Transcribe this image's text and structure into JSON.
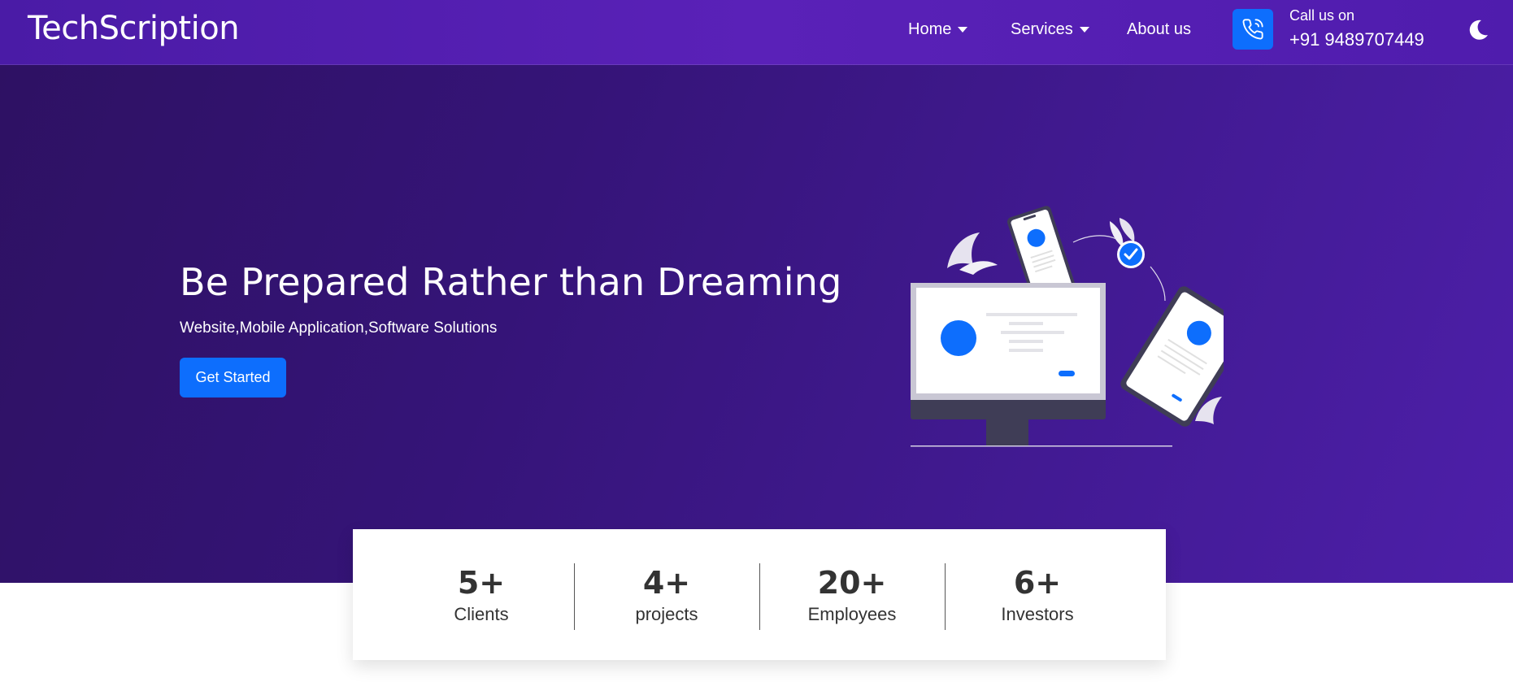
{
  "navbar": {
    "brand": "TechScription",
    "links": [
      {
        "label": "Home",
        "has_dropdown": true
      },
      {
        "label": "Services",
        "has_dropdown": true
      },
      {
        "label": "About us",
        "has_dropdown": false
      }
    ],
    "call_label": "Call us on",
    "call_number": "+91 9489707449",
    "icons": {
      "phone": "phone-icon",
      "theme_toggle": "moon-icon"
    }
  },
  "hero": {
    "title": "Be Prepared Rather than Dreaming",
    "subtitle": "Website,Mobile Application,Software Solutions",
    "cta_label": "Get Started",
    "illustration": "devices-illustration"
  },
  "stats": [
    {
      "value": "5+",
      "label": "Clients"
    },
    {
      "value": "4+",
      "label": "projects"
    },
    {
      "value": "20+",
      "label": "Employees"
    },
    {
      "value": "6+",
      "label": "Investors"
    }
  ],
  "colors": {
    "navbar": "#5220b0",
    "hero_start": "#2e1163",
    "hero_end": "#4d1fa9",
    "accent": "#0d6efd",
    "card_bg": "#ffffff"
  }
}
